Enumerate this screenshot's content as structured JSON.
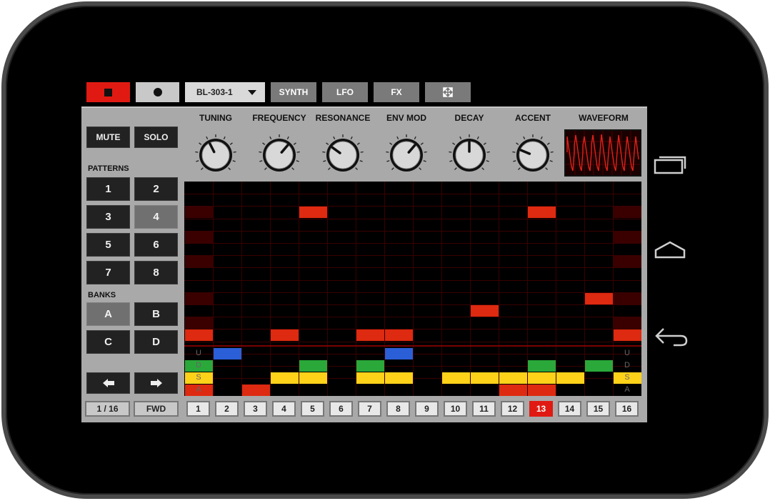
{
  "toolbar": {
    "preset": "BL-303-1",
    "synth": "SYNTH",
    "lfo": "LFO",
    "fx": "FX"
  },
  "left": {
    "mute": "MUTE",
    "solo": "SOLO",
    "patterns_label": "PATTERNS",
    "patterns": [
      "1",
      "2",
      "3",
      "4",
      "5",
      "6",
      "7",
      "8"
    ],
    "selected_pattern": "4",
    "banks_label": "BANKS",
    "banks": [
      "A",
      "B",
      "C",
      "D"
    ],
    "selected_bank": "A"
  },
  "knobs": [
    {
      "label": "TUNING",
      "value": 0.4
    },
    {
      "label": "FREQUENCY",
      "value": 0.65
    },
    {
      "label": "RESONANCE",
      "value": 0.3
    },
    {
      "label": "ENV MOD",
      "value": 0.65
    },
    {
      "label": "DECAY",
      "value": 0.5
    },
    {
      "label": "ACCENT",
      "value": 0.25
    }
  ],
  "waveform_label": "WAVEFORM",
  "row_letters": [
    "U",
    "D",
    "S",
    "A"
  ],
  "footer": {
    "resolution": "1 / 16",
    "direction": "FWD",
    "steps": [
      "1",
      "2",
      "3",
      "4",
      "5",
      "6",
      "7",
      "8",
      "9",
      "10",
      "11",
      "12",
      "13",
      "14",
      "15",
      "16"
    ],
    "current_step": 13
  },
  "colors": {
    "note": "#dd2a10",
    "up": "#2a5fd8",
    "down": "#2aa83a",
    "slide": "#ffd21a",
    "accent": "#dd2a10",
    "active_step": "#e01a12"
  }
}
